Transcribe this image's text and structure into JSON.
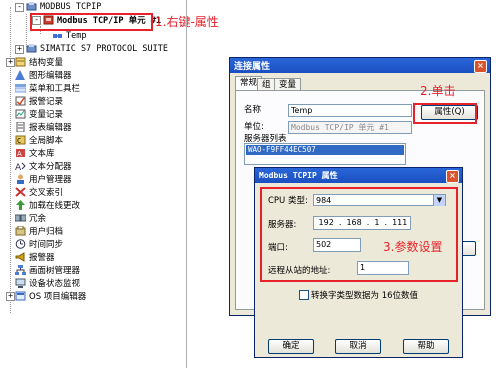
{
  "tree": {
    "items": [
      {
        "label": "MODBUS TCPIP",
        "mono": true,
        "bold": false
      },
      {
        "label": "Modbus TCP/IP 单元 #1",
        "mono": true,
        "bold": true
      },
      {
        "label": "Temp",
        "mono": true,
        "bold": false
      },
      {
        "label": "SIMATIC S7 PROTOCOL SUITE",
        "mono": true,
        "bold": false
      },
      {
        "label": "结构变量"
      },
      {
        "label": "图形编辑器"
      },
      {
        "label": "菜单和工具栏"
      },
      {
        "label": "报警记录"
      },
      {
        "label": "变量记录"
      },
      {
        "label": "报表编辑器"
      },
      {
        "label": "全局脚本"
      },
      {
        "label": "文本库"
      },
      {
        "label": "文本分配器"
      },
      {
        "label": "用户管理器"
      },
      {
        "label": "交叉索引"
      },
      {
        "label": "加载在线更改"
      },
      {
        "label": "冗余"
      },
      {
        "label": "用户归档"
      },
      {
        "label": "时间同步"
      },
      {
        "label": "报警器"
      },
      {
        "label": "画面树管理器"
      },
      {
        "label": "设备状态监视"
      },
      {
        "label": "OS 项目编辑器"
      }
    ]
  },
  "annotations": {
    "step1": "1.右键-属性",
    "step2": "2.单击",
    "step3": "3.参数设置"
  },
  "conn_dialog": {
    "title": "连接属性",
    "close": "×",
    "tabs": [
      "常规",
      "组",
      "变量"
    ],
    "name_label": "名称",
    "name_value": "Temp",
    "unit_label": "单位:",
    "unit_value": "Modbus TCP/IP 单元 #1",
    "props_button": "属性(Q)",
    "server_list_label": "服务器列表",
    "server_list_item": "WAO-F9FF44EC507"
  },
  "modbus_dialog": {
    "title": "Modbus TCPIP 属性",
    "close": "×",
    "cpu_label": "CPU 类型:",
    "cpu_value": "984",
    "server_label": "服务器:",
    "ip": [
      "192",
      "168",
      "1",
      "111"
    ],
    "port_label": "端口:",
    "port_value": "502",
    "slave_label": "远程从站的地址:",
    "slave_value": "1",
    "swap_label": "转换字类型数据为 16位数值",
    "ok_label": "确定",
    "cancel_label": "取消",
    "help_label": "帮助"
  },
  "colors": {
    "accent_red": "#e8222a",
    "title_blue": "#1a4fc0",
    "dialog_bg": "#ece9d8"
  }
}
